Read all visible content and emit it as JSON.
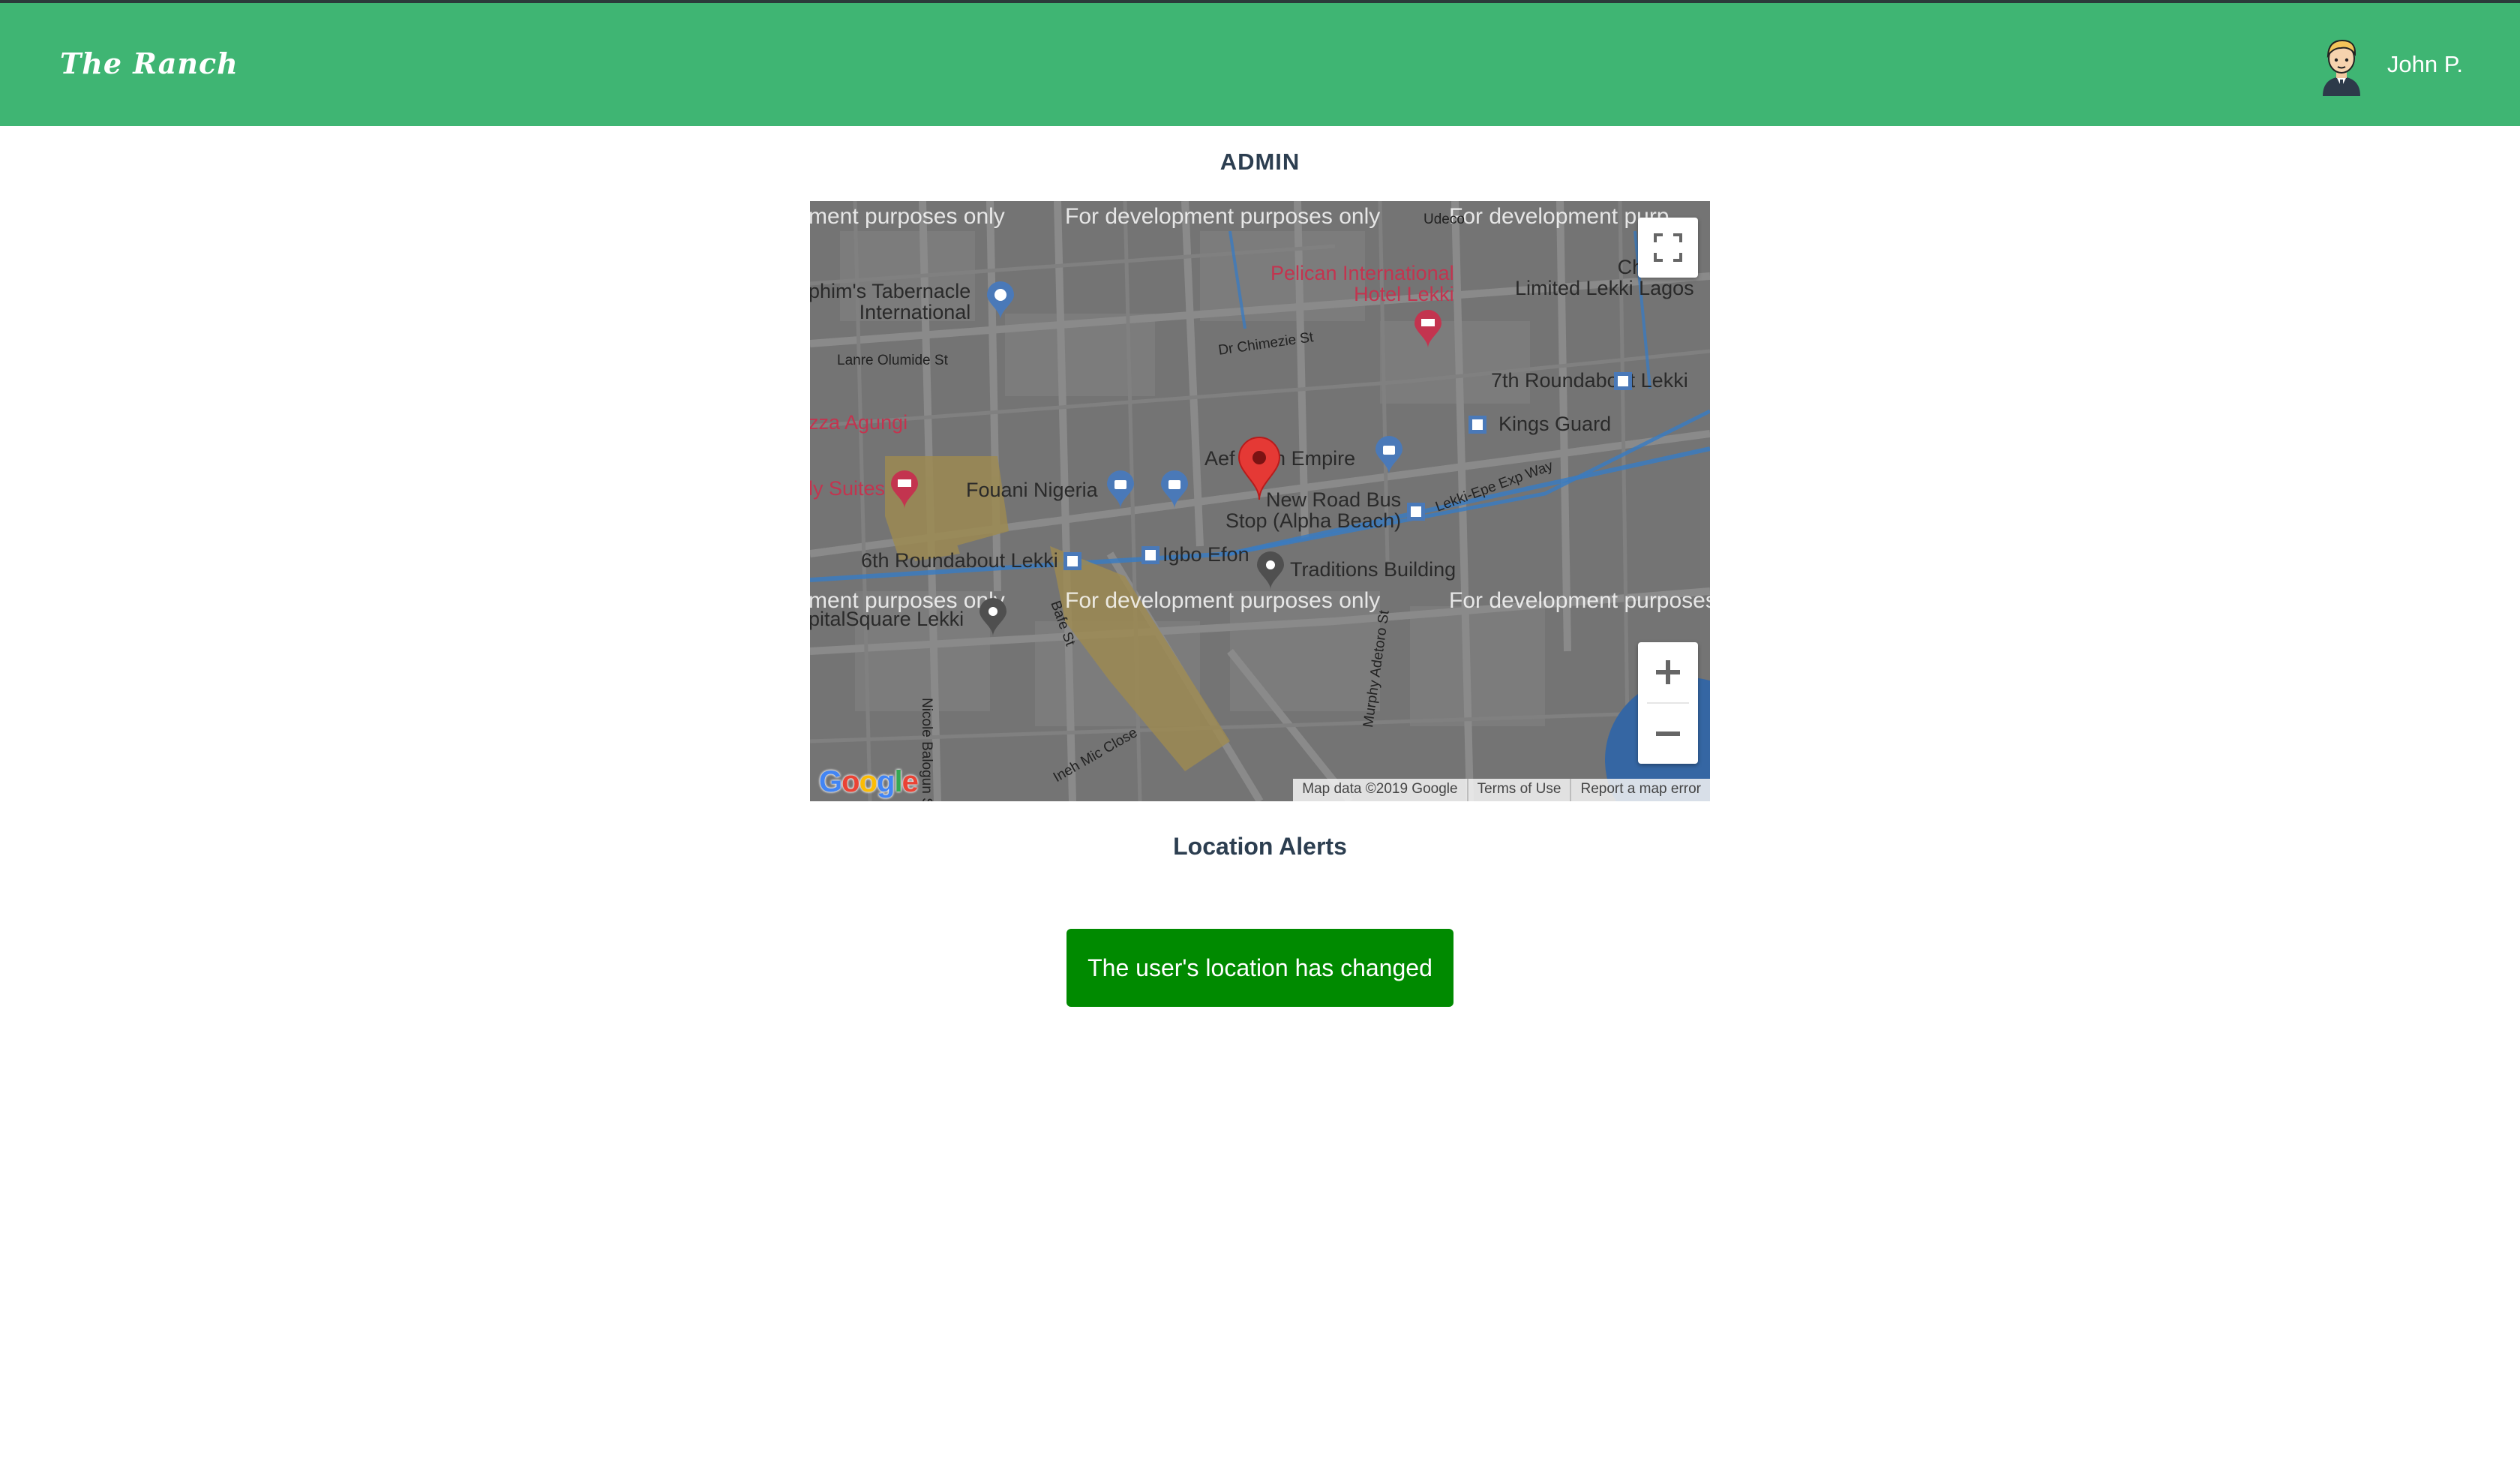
{
  "header": {
    "brand": "The Ranch",
    "user_name": "John P."
  },
  "page": {
    "title": "ADMIN"
  },
  "map": {
    "watermark": "For development purposes only",
    "watermark_partial_left": "ment purposes only",
    "watermark_partial_right_top": "For development purp",
    "watermark_partial_right_bottom": "For development purposes",
    "labels": {
      "tabernacle": "phim's Tabernacle\nInternational",
      "lanre": "Lanre Olumide St",
      "chimezie": "Dr Chimezie St",
      "pelican": "Pelican International\nHotel Lekki",
      "chevron": "Chevron\nLimited Lekki Lagos",
      "udeco": "Udeco",
      "roundabout7": "7th Roundabout Lekki",
      "kings_guard": "Kings Guard",
      "pizza": "zza Agungi",
      "suites": "ly Suites",
      "fouani": "Fouani Nigeria",
      "aefashion": "Aef     on Empire",
      "busstop": "New Road Bus\nStop (Alpha Beach)",
      "lekki_epe": "Lekki-Epe Exp Way",
      "roundabout6": "6th Roundabout Lekki",
      "igbo_efon": "Igbo Efon",
      "traditions": "Traditions Building",
      "capital_square": "pitalSquare Lekki",
      "nicole": "Nicole Balogun Street",
      "ineh": "Ineh Mic Close",
      "murphy": "Murphy Adetoro St",
      "bafe": "Bafe St"
    },
    "google_logo": "Google",
    "attribution": {
      "map_data": "Map data ©2019 Google",
      "terms": "Terms of Use",
      "report": "Report a map error"
    },
    "colors": {
      "marker": "#e53935",
      "water": "#3b7bbf",
      "poi_blue": "#4a79b8",
      "poi_pink": "#c3344f"
    }
  },
  "alerts": {
    "title": "Location Alerts",
    "message": "The user's location has changed"
  },
  "colors": {
    "navbar": "#3fb573",
    "alert": "#008a00",
    "text": "#2c3e50"
  }
}
